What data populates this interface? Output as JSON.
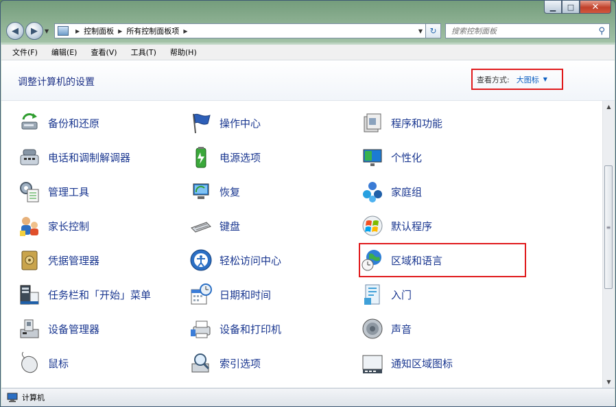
{
  "window": {
    "buttons": {
      "minimize": "▁",
      "maximize": "□",
      "close": "✕"
    }
  },
  "nav": {
    "back_glyph": "◀",
    "forward_glyph": "▶",
    "breadcrumbs": [
      "控制面板",
      "所有控制面板项"
    ],
    "refresh_glyph": "↻",
    "search_placeholder": "搜索控制面板"
  },
  "menu": [
    "文件(F)",
    "编辑(E)",
    "查看(V)",
    "工具(T)",
    "帮助(H)"
  ],
  "header": {
    "title": "调整计算机的设置",
    "view_by_label": "查看方式:",
    "view_by_value": "大图标"
  },
  "items": [
    {
      "label": "备份和还原",
      "icon": "backup-restore-icon"
    },
    {
      "label": "操作中心",
      "icon": "action-center-flag-icon"
    },
    {
      "label": "程序和功能",
      "icon": "programs-features-icon"
    },
    {
      "label": "电话和调制解调器",
      "icon": "phone-modem-icon"
    },
    {
      "label": "电源选项",
      "icon": "power-options-icon"
    },
    {
      "label": "个性化",
      "icon": "personalization-icon"
    },
    {
      "label": "管理工具",
      "icon": "admin-tools-icon"
    },
    {
      "label": "恢复",
      "icon": "recovery-icon"
    },
    {
      "label": "家庭组",
      "icon": "homegroup-icon"
    },
    {
      "label": "家长控制",
      "icon": "parental-controls-icon"
    },
    {
      "label": "键盘",
      "icon": "keyboard-icon"
    },
    {
      "label": "默认程序",
      "icon": "default-programs-icon"
    },
    {
      "label": "凭据管理器",
      "icon": "credential-manager-icon"
    },
    {
      "label": "轻松访问中心",
      "icon": "ease-of-access-icon"
    },
    {
      "label": "区域和语言",
      "icon": "region-language-icon"
    },
    {
      "label": "任务栏和「开始」菜单",
      "icon": "taskbar-start-menu-icon"
    },
    {
      "label": "日期和时间",
      "icon": "date-time-icon"
    },
    {
      "label": "入门",
      "icon": "getting-started-icon"
    },
    {
      "label": "设备管理器",
      "icon": "device-manager-icon"
    },
    {
      "label": "设备和打印机",
      "icon": "devices-printers-icon"
    },
    {
      "label": "声音",
      "icon": "sound-icon"
    },
    {
      "label": "鼠标",
      "icon": "mouse-icon"
    },
    {
      "label": "索引选项",
      "icon": "indexing-options-icon"
    },
    {
      "label": "通知区域图标",
      "icon": "notification-area-icon"
    }
  ],
  "status": {
    "text": "计算机"
  },
  "colors": {
    "link_blue": "#1a3790",
    "highlight_red": "#e0191b",
    "title_blue": "#1e3287"
  }
}
